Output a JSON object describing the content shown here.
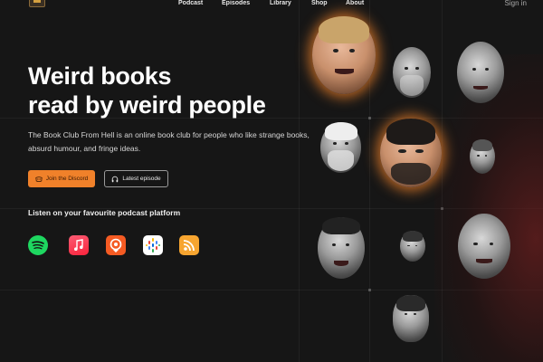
{
  "nav": {
    "items": [
      {
        "label": "Podcast"
      },
      {
        "label": "Episodes"
      },
      {
        "label": "Library"
      },
      {
        "label": "Shop"
      },
      {
        "label": "About"
      }
    ],
    "signin_label": "Sign in"
  },
  "hero": {
    "title_line1": "Weird books",
    "title_line2": "read by weird people",
    "description": "The Book Club From Hell is an online book club for people who like strange books, absurd humour, and fringe ideas.",
    "primary_button": "Join the Discord",
    "secondary_button": "Latest episode"
  },
  "platforms": {
    "heading": "Listen on your favourite podcast platform",
    "icons": [
      "spotify-icon",
      "apple-podcasts-icon",
      "castbox-icon",
      "google-podcasts-icon",
      "rss-icon"
    ]
  },
  "colors": {
    "background": "#161616",
    "accent": "#f0812a",
    "text": "#ffffff"
  }
}
